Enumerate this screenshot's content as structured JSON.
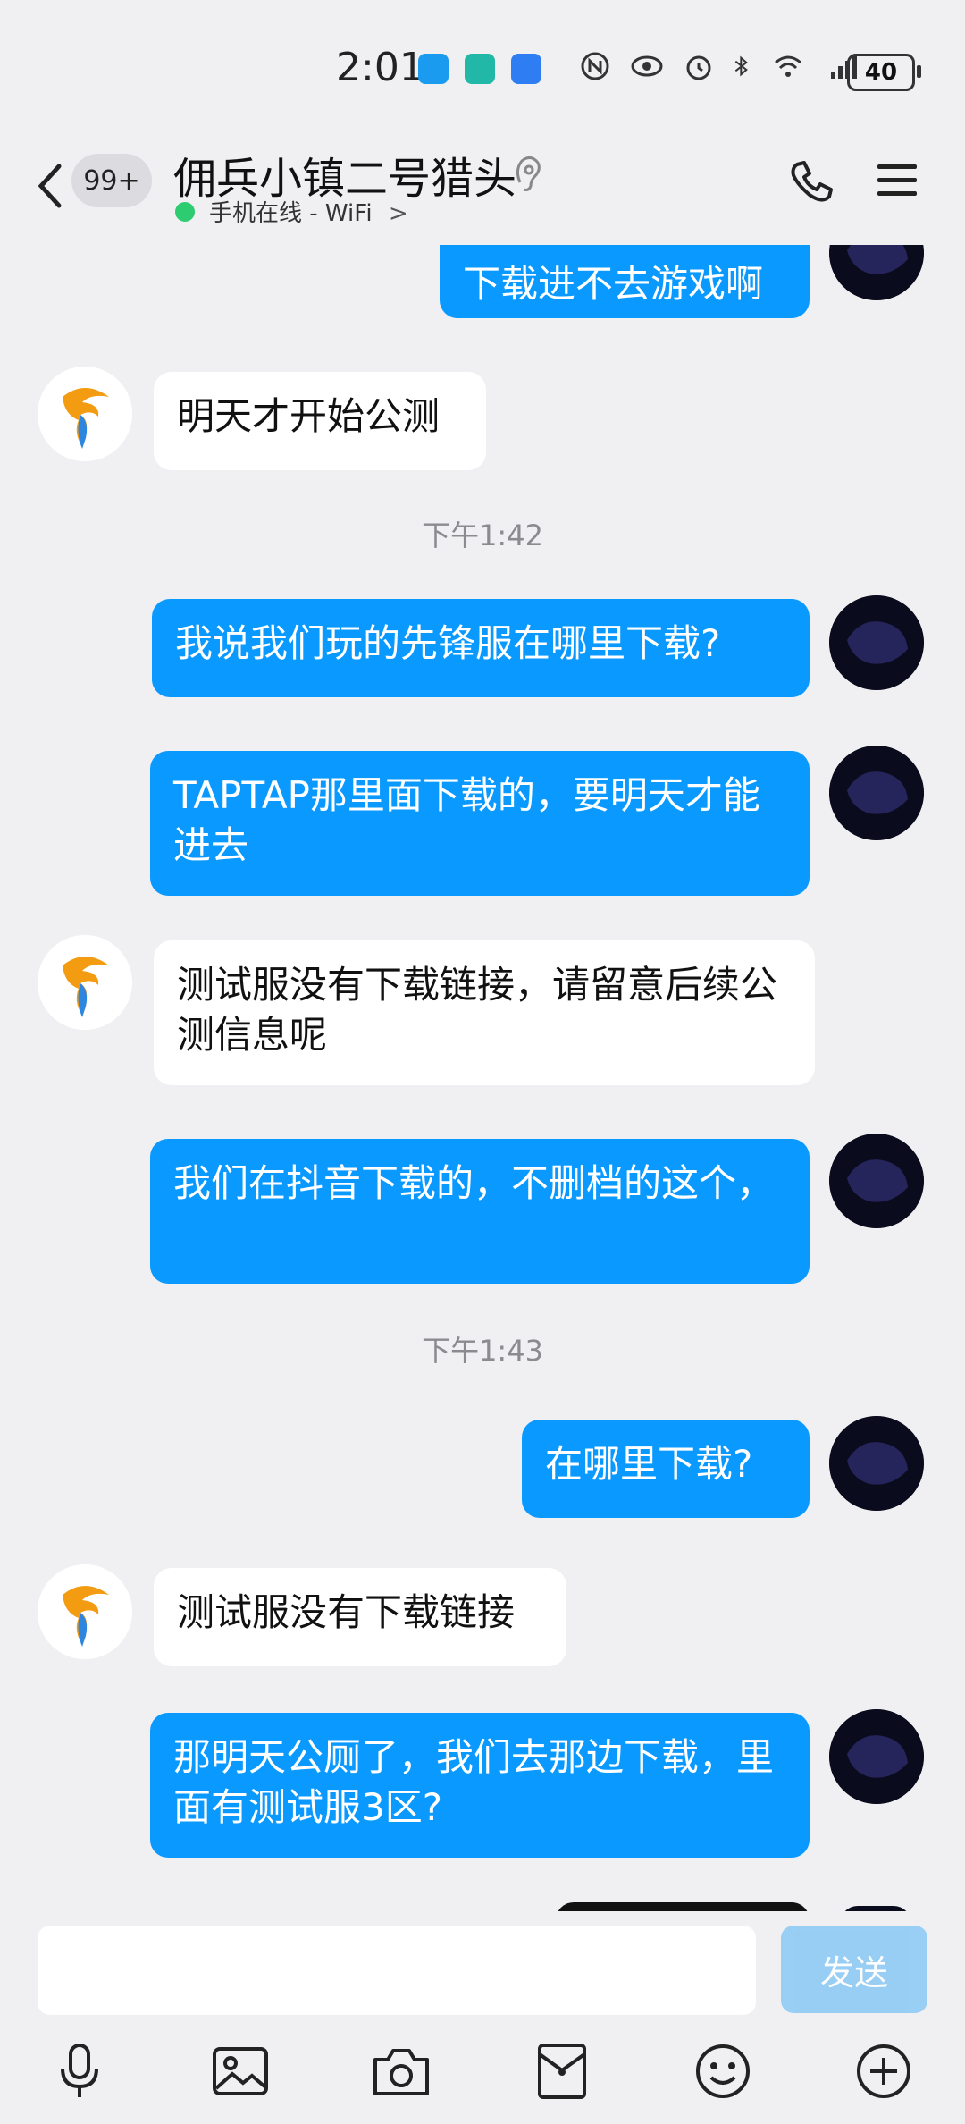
{
  "status_bar": {
    "time": "2:01",
    "battery": "40"
  },
  "header": {
    "back_badge": "99+",
    "title": "佣兵小镇二号猎头",
    "subtitle": "手机在线 - WiFi",
    "subtitle_chevron": ">"
  },
  "messages": [
    {
      "side": "out",
      "text": "下载进不去游戏啊"
    },
    {
      "side": "in",
      "text": "明天才开始公测"
    },
    {
      "timestamp": "下午1:42"
    },
    {
      "side": "out",
      "text": "我说我们玩的先锋服在哪里下载?"
    },
    {
      "side": "out",
      "text": "TAPTAP那里面下载的，要明天才能进去"
    },
    {
      "side": "in",
      "text": "测试服没有下载链接，请留意后续公测信息呢"
    },
    {
      "side": "out",
      "text": "我们在抖音下载的，不删档的这个，"
    },
    {
      "timestamp": "下午1:43"
    },
    {
      "side": "out",
      "text": "在哪里下载?"
    },
    {
      "side": "in",
      "text": "测试服没有下载链接"
    },
    {
      "side": "out",
      "text": "那明天公厕了，我们去那边下载，里面有测试服3区?"
    }
  ],
  "input": {
    "value": "",
    "send_label": "发送"
  },
  "toolbar": {
    "icons": [
      "microphone-icon",
      "image-icon",
      "camera-icon",
      "red-packet-icon",
      "emoji-icon",
      "plus-icon"
    ]
  },
  "colors": {
    "outgoing_bubble": "#0a99ff",
    "incoming_bubble": "#ffffff",
    "background": "#f0f0f3",
    "online": "#2ecc71"
  }
}
